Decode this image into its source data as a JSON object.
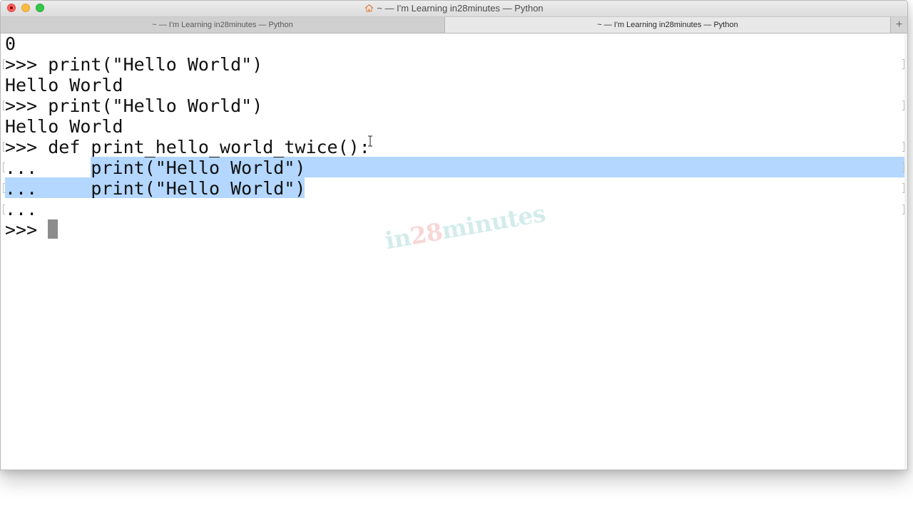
{
  "window": {
    "title": "~ — I'm Learning in28minutes — Python",
    "icon": "home-icon"
  },
  "tabs": [
    {
      "label": "~ — I'm Learning in28minutes — Python",
      "active": false
    },
    {
      "label": "~ — I'm Learning in28minutes — Python",
      "active": true
    }
  ],
  "tab_add_label": "+",
  "terminal": {
    "lines": [
      {
        "prompt": "",
        "code": "0"
      },
      {
        "prompt": ">>> ",
        "code": "print(\"Hello World\")"
      },
      {
        "prompt": "",
        "code": "Hello World"
      },
      {
        "prompt": ">>> ",
        "code": "print(\"Hello World\")"
      },
      {
        "prompt": "",
        "code": "Hello World"
      },
      {
        "prompt": ">>> ",
        "code": "def print_hello_world_twice():"
      },
      {
        "prompt": "... ",
        "code": "    print(\"Hello World\")"
      },
      {
        "prompt": "... ",
        "code": "    print(\"Hello World\")"
      },
      {
        "prompt": "...",
        "code": ""
      },
      {
        "prompt": ">>> ",
        "code": ""
      }
    ],
    "selection_color": "#b3d7ff",
    "cursor_color": "#8c8c8c"
  },
  "watermark": {
    "part1": "in",
    "part2": "28",
    "part3": "minutes"
  },
  "colors": {
    "close": "#fc605c",
    "minimize": "#fdbc40",
    "maximize": "#34c84a"
  }
}
